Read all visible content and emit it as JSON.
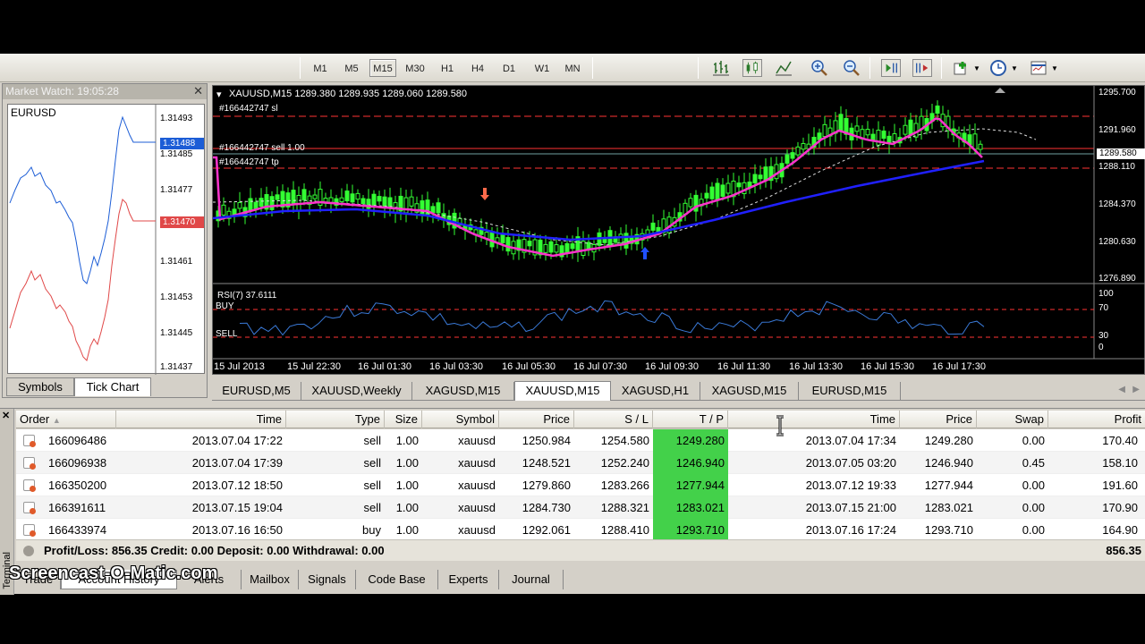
{
  "toolbar": {
    "timeframes": [
      "M1",
      "M5",
      "M15",
      "M30",
      "H1",
      "H4",
      "D1",
      "W1",
      "MN"
    ],
    "active_timeframe": "M15"
  },
  "market_watch": {
    "title": "Market Watch: 19:05:28",
    "symbol": "EURUSD",
    "price_labels": [
      "1.31493",
      "1.31485",
      "1.31477",
      "1.31469",
      "1.31461",
      "1.31453",
      "1.31445",
      "1.31437"
    ],
    "ask_tag": "1.31488",
    "bid_tag": "1.31470",
    "ask_color": "#1c5dd6",
    "bid_color": "#e04848",
    "tabs": [
      "Symbols",
      "Tick Chart"
    ],
    "active_tab": "Tick Chart"
  },
  "chart": {
    "header": "XAUUSD,M15  1289.380 1289.935 1289.060 1289.580",
    "order_sl": "#166442747 sl",
    "order_sell": "#166442747 sell 1.00",
    "order_tp": "#166442747 tp",
    "price_labels": [
      "1295.700",
      "1291.960",
      "1288.110",
      "1284.370",
      "1280.630",
      "1276.890"
    ],
    "current_price": "1289.580",
    "rsi_label": "RSI(7) 37.6111",
    "rsi_buy": "BUY",
    "rsi_sell": "SELL",
    "rsi_levels": [
      "100",
      "70",
      "30",
      "0"
    ],
    "time_labels": [
      "15 Jul 2013",
      "15 Jul 22:30",
      "16 Jul 01:30",
      "16 Jul 03:30",
      "16 Jul 05:30",
      "16 Jul 07:30",
      "16 Jul 09:30",
      "16 Jul 11:30",
      "16 Jul 13:30",
      "16 Jul 15:30",
      "16 Jul 17:30"
    ]
  },
  "chart_tabs": [
    "EURUSD,M5",
    "XAUUSD,Weekly",
    "XAGUSD,M15",
    "XAUUSD,M15",
    "XAGUSD,H1",
    "XAGUSD,M15",
    "EURUSD,M15"
  ],
  "active_chart_tab": "XAUUSD,M15",
  "terminal": {
    "side_label": "Terminal",
    "columns": [
      "Order",
      "Time",
      "Type",
      "Size",
      "Symbol",
      "Price",
      "S / L",
      "T / P",
      "Time",
      "Price",
      "Swap",
      "Profit"
    ],
    "rows": [
      {
        "order": "166096486",
        "open_time": "2013.07.04 17:22",
        "type": "sell",
        "size": "1.00",
        "symbol": "xauusd",
        "price": "1250.984",
        "sl": "1254.580",
        "tp": "1249.280",
        "close_time": "2013.07.04 17:34",
        "close_price": "1249.280",
        "swap": "0.00",
        "profit": "170.40"
      },
      {
        "order": "166096938",
        "open_time": "2013.07.04 17:39",
        "type": "sell",
        "size": "1.00",
        "symbol": "xauusd",
        "price": "1248.521",
        "sl": "1252.240",
        "tp": "1246.940",
        "close_time": "2013.07.05 03:20",
        "close_price": "1246.940",
        "swap": "0.45",
        "profit": "158.10"
      },
      {
        "order": "166350200",
        "open_time": "2013.07.12 18:50",
        "type": "sell",
        "size": "1.00",
        "symbol": "xauusd",
        "price": "1279.860",
        "sl": "1283.266",
        "tp": "1277.944",
        "close_time": "2013.07.12 19:33",
        "close_price": "1277.944",
        "swap": "0.00",
        "profit": "191.60"
      },
      {
        "order": "166391611",
        "open_time": "2013.07.15 19:04",
        "type": "sell",
        "size": "1.00",
        "symbol": "xauusd",
        "price": "1284.730",
        "sl": "1288.321",
        "tp": "1283.021",
        "close_time": "2013.07.15 21:00",
        "close_price": "1283.021",
        "swap": "0.00",
        "profit": "170.90"
      },
      {
        "order": "166433974",
        "open_time": "2013.07.16 16:50",
        "type": "buy",
        "size": "1.00",
        "symbol": "xauusd",
        "price": "1292.061",
        "sl": "1288.410",
        "tp": "1293.710",
        "close_time": "2013.07.16 17:24",
        "close_price": "1293.710",
        "swap": "0.00",
        "profit": "164.90"
      }
    ],
    "summary": "Profit/Loss: 856.35  Credit: 0.00  Deposit: 0.00  Withdrawal: 0.00",
    "summary_total": "856.35",
    "bottom_tabs": [
      "Trade",
      "Account History",
      "Alerts",
      "Mailbox",
      "Signals",
      "Code Base",
      "Experts",
      "Journal"
    ]
  },
  "watermark": "Screencast-O-Matic.com",
  "colors": {
    "tp_highlight": "#43d14a",
    "ma_fast": "#ff33cc",
    "ma_slow": "#2020ff",
    "candle": "#33ff33",
    "level_line": "#ff3333"
  }
}
